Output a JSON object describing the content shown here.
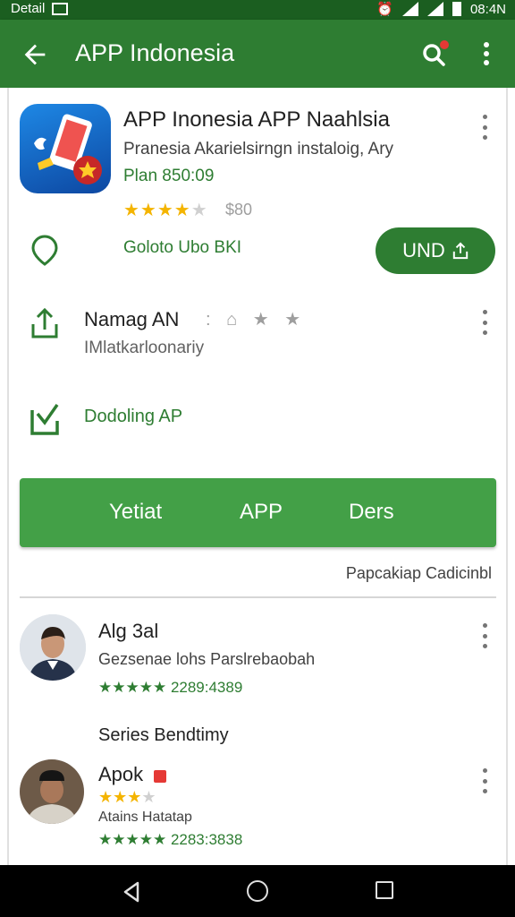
{
  "status_bar": {
    "left_text": "Detail",
    "right_text": "08:4N"
  },
  "app_bar": {
    "title": "APP Indonesia"
  },
  "app": {
    "name": "APP Inonesia APP Naahlsia",
    "description": "Pranesia Akarielsirngn instaloig, Ary",
    "price": "Plan 850:09",
    "rating_stars": "★★★★",
    "rating_stars_off": "★",
    "rating": 4,
    "rating_count": "$80"
  },
  "location": {
    "text": "Goloto Ubo BKI"
  },
  "install_button": {
    "label": "UND"
  },
  "manage": {
    "title": "Namag AN",
    "extra": ": ⌂ ★ ★",
    "subtitle": "IMlatkarloonariy"
  },
  "download": {
    "text": "Dodoling AP"
  },
  "action_bar": {
    "left": "Yetiat",
    "center": "APP",
    "right": "Ders"
  },
  "caption": "Papcakiap Cadicinbl",
  "reviews": [
    {
      "name": "Alg 3al",
      "text": "Gezsenae lohs Parslrebaobah",
      "stars": "★★★★★",
      "meta": "2289:4389"
    },
    {
      "name": "Apok",
      "sub": "Atains Hatatap",
      "stars": "★★★★★",
      "meta": "2283:3838",
      "gold_stars": "★★★",
      "gold_off": "★"
    }
  ],
  "section_title": "Series Bendtimy",
  "colors": {
    "primary": "#2e7d32",
    "primary_dark": "#1b5e20",
    "accent": "#43a047",
    "star": "#f4b400"
  }
}
